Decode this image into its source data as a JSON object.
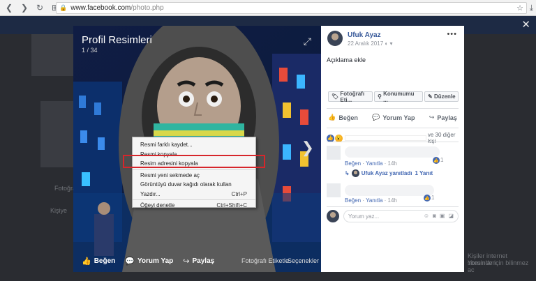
{
  "browser": {
    "url_domain": "www.facebook.com",
    "url_path": "/photo.php"
  },
  "viewer": {
    "album_title": "Profil Resimleri",
    "photo_count": "1 / 34",
    "actions": {
      "like": "Beğen",
      "comment": "Yorum Yap",
      "share": "Paylaş",
      "tag": "Fotoğrafı Etiketle",
      "options": "Seçenekler"
    }
  },
  "context_menu": {
    "items": [
      {
        "label": "Resmi farklı kaydet...",
        "shortcut": ""
      },
      {
        "label": "Resmi kopyala",
        "shortcut": ""
      },
      {
        "label": "Resim adresini kopyala",
        "shortcut": "",
        "highlighted": true
      },
      {
        "label": "Resmi yeni sekmede aç",
        "shortcut": ""
      },
      {
        "label": "Görüntüyü duvar kağıdı olarak kullan",
        "shortcut": ""
      },
      {
        "label": "Yazdır...",
        "shortcut": "Ctrl+P"
      },
      {
        "label": "Öğeyi denetle",
        "shortcut": "Ctrl+Shift+C"
      }
    ],
    "highlight_color": "#d6262b"
  },
  "panel": {
    "author": "Ufuk Ayaz",
    "date": "22 Aralık 2017",
    "privacy": "◐ ▾",
    "description": "Açıklama ekle",
    "tag_buttons": [
      "Fotoğrafı Eti...",
      "Konumumu ...",
      "Düzenle"
    ],
    "reactions": {
      "like": "Beğen",
      "comment": "Yorum Yap",
      "share": "Paylaş"
    },
    "likes_text": "ve 30 diğer kişi",
    "comments": [
      {
        "like": "Beğen",
        "reply": "Yanıtla",
        "time": "14h",
        "likes": "1"
      },
      {
        "like": "Beğen",
        "reply": "Yanıtla",
        "time": "14h",
        "likes": "1"
      }
    ],
    "reply_summary": {
      "text": "Ufuk Ayaz yanıtladı",
      "count": "1 Yanıt"
    },
    "write_placeholder": "Yorum yaz...",
    "accent": "#4267b2"
  },
  "background_page": {
    "left_labels": [
      "Fotoğraf",
      "Kişiye"
    ],
    "right_labels": [
      "Kişiler internet sitesinden",
      "Yorumlar için bilinmez ac"
    ]
  }
}
